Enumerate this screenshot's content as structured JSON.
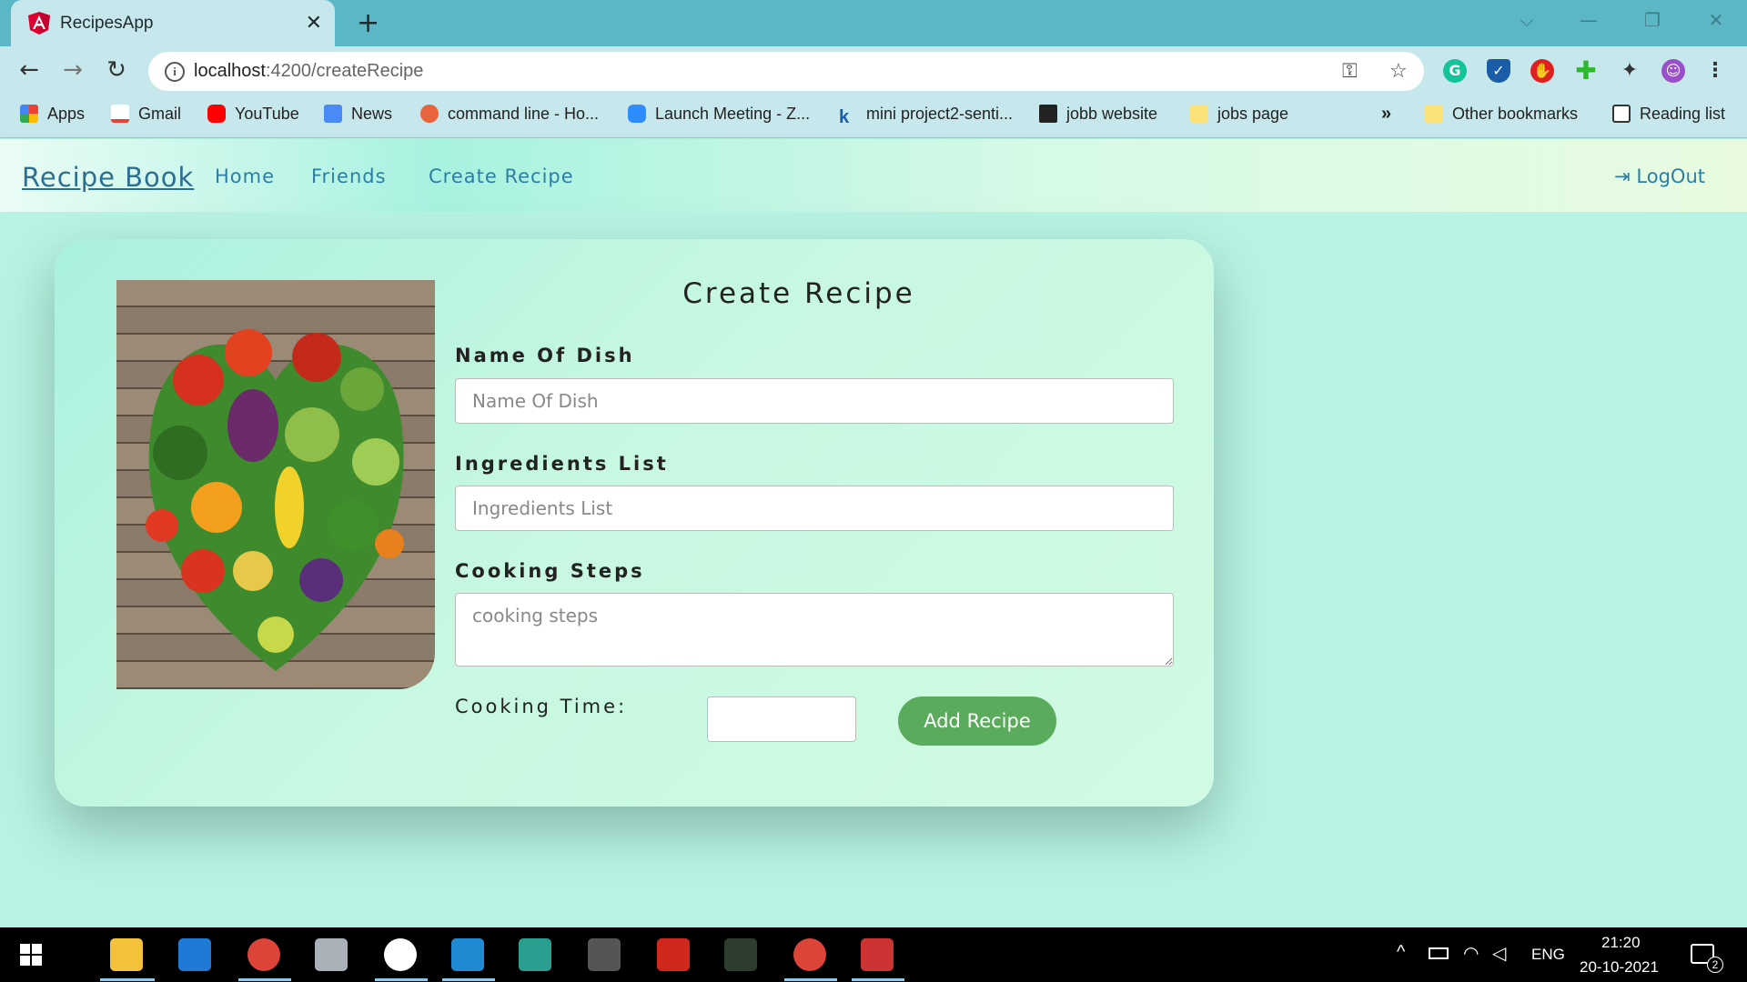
{
  "browser": {
    "tab_title": "RecipesApp",
    "tab_close": "✕",
    "new_tab": "+",
    "url_host": "localhost",
    "url_path": ":4200/createRecipe",
    "window_controls": [
      "⌵",
      "—",
      "❐",
      "✕"
    ]
  },
  "bookmarks": [
    {
      "label": "Apps",
      "icon": "apps-grid-icon"
    },
    {
      "label": "Gmail",
      "icon": "gmail-icon"
    },
    {
      "label": "YouTube",
      "icon": "youtube-icon"
    },
    {
      "label": "News",
      "icon": "news-icon"
    },
    {
      "label": "command line - Ho...",
      "icon": "ask-icon"
    },
    {
      "label": "Launch Meeting - Z...",
      "icon": "zoom-icon"
    },
    {
      "label": "mini project2-senti...",
      "icon": "k-icon"
    },
    {
      "label": "jobb website",
      "icon": "graduation-cap-icon"
    },
    {
      "label": "jobs page",
      "icon": "folder-icon"
    }
  ],
  "bookmarks_overflow": "»",
  "other_bookmarks": "Other bookmarks",
  "reading_list": "Reading list",
  "nav": {
    "brand": "Recipe Book",
    "links": [
      "Home",
      "Friends",
      "Create Recipe"
    ],
    "logout": "LogOut"
  },
  "form": {
    "title": "Create Recipe",
    "name_label": "Name Of Dish",
    "name_placeholder": "Name Of Dish",
    "ingredients_label": "Ingredients List",
    "ingredients_placeholder": "Ingredients List",
    "steps_label": "Cooking Steps",
    "steps_placeholder": "cooking steps",
    "time_label": "Cooking Time:",
    "time_value": "",
    "submit": "Add Recipe"
  },
  "taskbar": {
    "language": "ENG",
    "time": "21:20",
    "date": "20-10-2021",
    "notification_count": "2"
  },
  "colors": {
    "accent_green": "#5aab5b",
    "nav_link": "#2d7ea3",
    "page_bg": "#b9f3e3",
    "chrome_frame": "#5bb6c5"
  }
}
